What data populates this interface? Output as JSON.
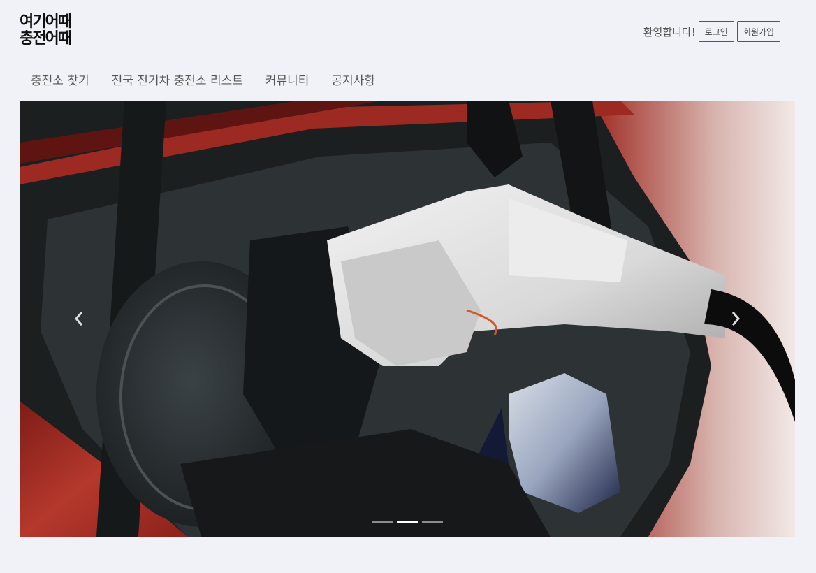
{
  "brand": {
    "line1": "여기어때",
    "line2": "충전어때"
  },
  "user": {
    "welcome": "환영합니다!",
    "login_label": "로그인",
    "signup_label": "회원가입"
  },
  "nav": {
    "items": [
      {
        "label": "충전소 찾기"
      },
      {
        "label": "전국 전기차 충전소 리스트"
      },
      {
        "label": "커뮤니티"
      },
      {
        "label": "공지사항"
      }
    ]
  },
  "carousel": {
    "slide_count": 3,
    "active_index": 1,
    "prev_icon": "chevron-left-icon",
    "next_icon": "chevron-right-icon"
  },
  "colors": {
    "page_bg": "#f1f2f7",
    "car_red": "#b0322a",
    "plug_white": "#dcdcdc"
  }
}
